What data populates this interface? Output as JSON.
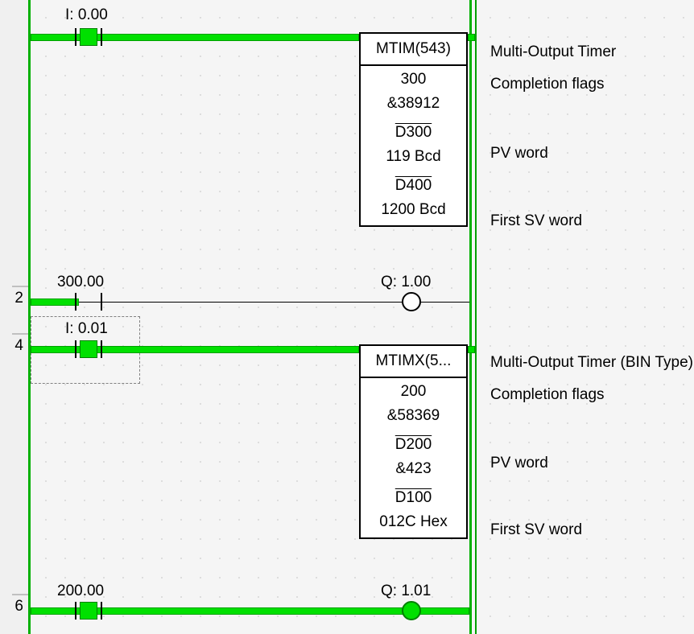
{
  "gutter": {
    "n2": "2",
    "n4": "4",
    "n6": "6"
  },
  "rung0": {
    "contact_label": "I: 0.00",
    "fb": {
      "title": "MTIM(543)",
      "op1": "300",
      "op1v": "&38912",
      "op2": "D300",
      "op2v": "119 Bcd",
      "op3": "D400",
      "op3v": "1200 Bcd"
    },
    "side": {
      "s1": "Multi-Output Timer",
      "s2": "Completion flags",
      "s3": "PV word",
      "s4": "First SV word"
    }
  },
  "rung1": {
    "contact_label": "300.00",
    "out_label": "Q: 1.00"
  },
  "rung2": {
    "contact_label": "I: 0.01",
    "fb": {
      "title": "MTIMX(5...",
      "op1": "200",
      "op1v": "&58369",
      "op2": "D200",
      "op2v": "&423",
      "op3": "D100",
      "op3v": "012C Hex"
    },
    "side": {
      "s1": "Multi-Output Timer (BIN Type)",
      "s2": "Completion flags",
      "s3": "PV word",
      "s4": "First SV word"
    }
  },
  "rung3": {
    "contact_label": "200.00",
    "out_label": "Q: 1.01"
  }
}
